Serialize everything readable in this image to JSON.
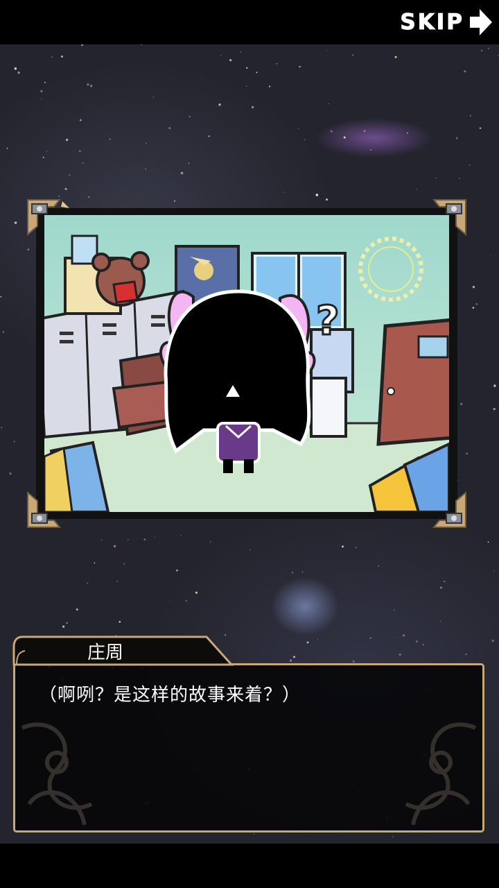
{
  "top_bar": {
    "skip_label": "SKIP",
    "skip_icon": "arrow-right-icon"
  },
  "scene": {
    "image_name": "story-scene-illustration",
    "question_mark": "?"
  },
  "dialog": {
    "speaker_name": "庄周",
    "text": "（啊咧？是这样的故事来着？）"
  },
  "colors": {
    "background": "#24242e",
    "frame_gold": "#c9a878",
    "dialog_bg": "#08080a",
    "text": "#ffffff"
  }
}
